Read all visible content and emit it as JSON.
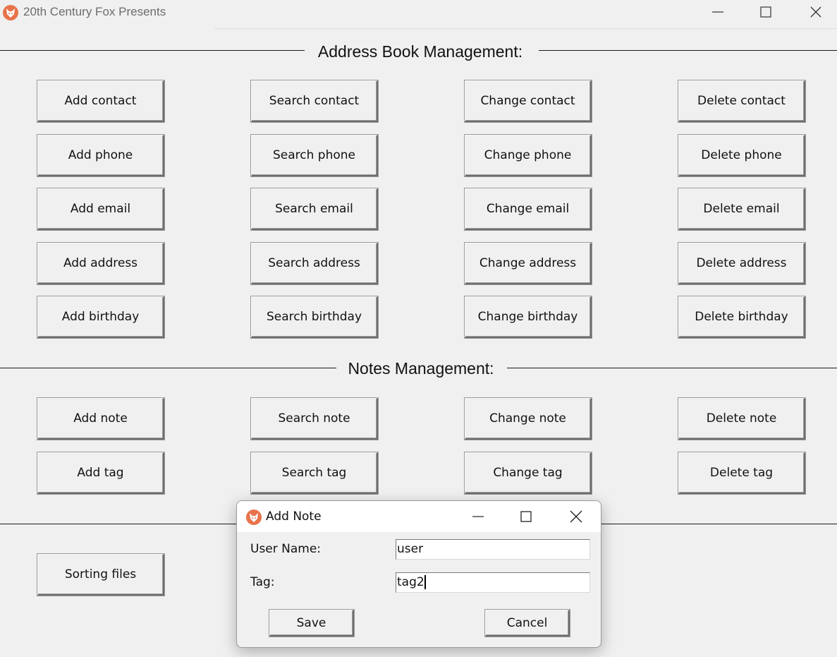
{
  "window": {
    "title": "20th Century Fox Presents"
  },
  "sections": {
    "address_book": "Address Book Management:",
    "notes": "Notes Management:"
  },
  "address_buttons": [
    [
      "Add contact",
      "Search contact",
      "Change contact",
      "Delete contact"
    ],
    [
      "Add phone",
      "Search phone",
      "Change phone",
      "Delete phone"
    ],
    [
      "Add email",
      "Search email",
      "Change email",
      "Delete email"
    ],
    [
      "Add address",
      "Search address",
      "Change address",
      "Delete address"
    ],
    [
      "Add birthday",
      "Search birthday",
      "Change birthday",
      "Delete birthday"
    ]
  ],
  "notes_buttons": [
    [
      "Add note",
      "Search note",
      "Change note",
      "Delete note"
    ],
    [
      "Add tag",
      "Search tag",
      "Change tag",
      "Delete tag"
    ]
  ],
  "sorting_button": "Sorting files",
  "dialog": {
    "title": "Add Note",
    "user_label": "User Name:",
    "user_value": "user",
    "tag_label": "Tag:",
    "tag_value": "tag2",
    "save_label": "Save",
    "cancel_label": "Cancel"
  },
  "colors": {
    "background": "#f0f0f0",
    "app_icon": "#e8734a"
  },
  "icons": [
    "fox-app-icon",
    "minimize-icon",
    "maximize-icon",
    "close-icon"
  ]
}
